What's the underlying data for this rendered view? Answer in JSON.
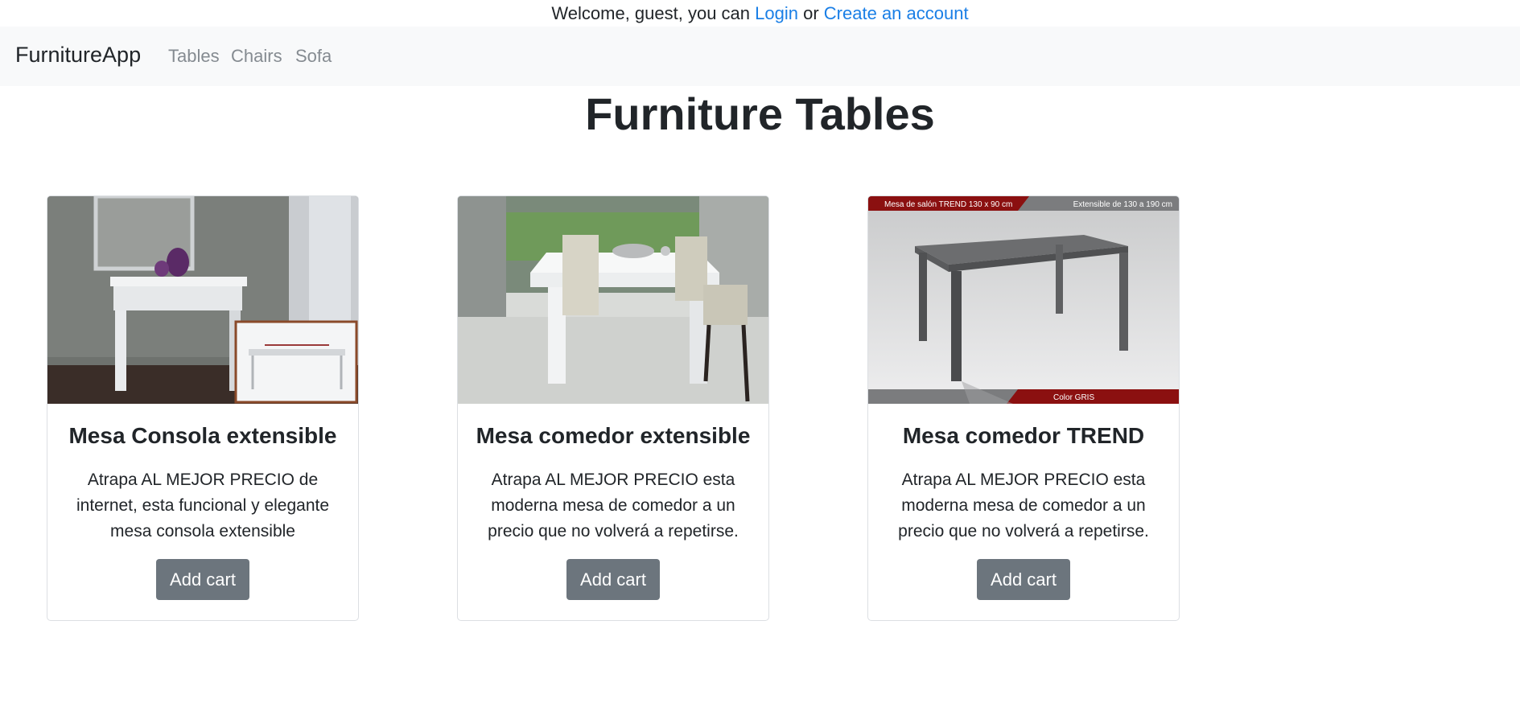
{
  "header": {
    "welcome_prefix": "Welcome, guest, you can",
    "login_label": "Login",
    "or_text": "or",
    "create_account_label": "Create an account"
  },
  "navbar": {
    "brand": "FurnitureApp",
    "links": [
      "Tables",
      "Chairs",
      "Sofa"
    ]
  },
  "page": {
    "title": "Furniture Tables"
  },
  "products": [
    {
      "title": "Mesa Consola extensible",
      "description": "Atrapa AL MEJOR PRECIO de internet, esta funcional y elegante mesa consola extensible",
      "button": "Add cart"
    },
    {
      "title": "Mesa comedor extensible",
      "description": "Atrapa AL MEJOR PRECIO esta moderna mesa de comedor a un precio que no volverá a repetirse.",
      "button": "Add cart"
    },
    {
      "title": "Mesa comedor TREND",
      "description": "Atrapa AL MEJOR PRECIO esta moderna mesa de comedor a un precio que no volverá a repetirse.",
      "button": "Add cart",
      "image_banner": {
        "top_left": "Mesa de salón TREND 130 x 90 cm",
        "top_right": "Extensible de 130 a 190 cm",
        "bottom_right": "Color GRIS"
      }
    }
  ],
  "colors": {
    "link": "#1a7fe6",
    "button": "#6c757d",
    "navbar_bg": "#f8f9fa",
    "banner_red": "#8b1010"
  }
}
